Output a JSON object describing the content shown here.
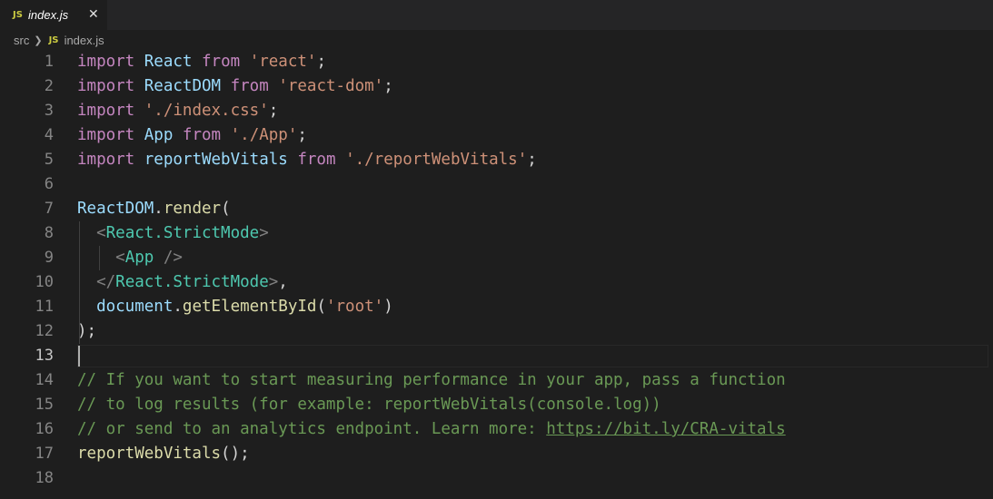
{
  "tab": {
    "icon": "JS",
    "title": "index.js",
    "close": "✕"
  },
  "breadcrumb": {
    "folder": "src",
    "sep": "❯",
    "file_icon": "JS",
    "file": "index.js"
  },
  "editor": {
    "active_line": 13,
    "lines": [
      {
        "n": "1",
        "tokens": [
          {
            "c": "kw",
            "t": "import"
          },
          {
            "t": " "
          },
          {
            "c": "var",
            "t": "React"
          },
          {
            "t": " "
          },
          {
            "c": "kw",
            "t": "from"
          },
          {
            "t": " "
          },
          {
            "c": "str",
            "t": "'react'"
          },
          {
            "t": ";"
          }
        ]
      },
      {
        "n": "2",
        "tokens": [
          {
            "c": "kw",
            "t": "import"
          },
          {
            "t": " "
          },
          {
            "c": "var",
            "t": "ReactDOM"
          },
          {
            "t": " "
          },
          {
            "c": "kw",
            "t": "from"
          },
          {
            "t": " "
          },
          {
            "c": "str",
            "t": "'react-dom'"
          },
          {
            "t": ";"
          }
        ]
      },
      {
        "n": "3",
        "tokens": [
          {
            "c": "kw",
            "t": "import"
          },
          {
            "t": " "
          },
          {
            "c": "str",
            "t": "'./index.css'"
          },
          {
            "t": ";"
          }
        ]
      },
      {
        "n": "4",
        "tokens": [
          {
            "c": "kw",
            "t": "import"
          },
          {
            "t": " "
          },
          {
            "c": "var",
            "t": "App"
          },
          {
            "t": " "
          },
          {
            "c": "kw",
            "t": "from"
          },
          {
            "t": " "
          },
          {
            "c": "str",
            "t": "'./App'"
          },
          {
            "t": ";"
          }
        ]
      },
      {
        "n": "5",
        "tokens": [
          {
            "c": "kw",
            "t": "import"
          },
          {
            "t": " "
          },
          {
            "c": "var",
            "t": "reportWebVitals"
          },
          {
            "t": " "
          },
          {
            "c": "kw",
            "t": "from"
          },
          {
            "t": " "
          },
          {
            "c": "str",
            "t": "'./reportWebVitals'"
          },
          {
            "t": ";"
          }
        ]
      },
      {
        "n": "6",
        "tokens": []
      },
      {
        "n": "7",
        "tokens": [
          {
            "c": "var",
            "t": "ReactDOM"
          },
          {
            "t": "."
          },
          {
            "c": "fn",
            "t": "render"
          },
          {
            "t": "("
          }
        ]
      },
      {
        "n": "8",
        "tokens": [
          {
            "t": "  "
          },
          {
            "c": "punc",
            "t": "<"
          },
          {
            "c": "tag",
            "t": "React.StrictMode"
          },
          {
            "c": "punc",
            "t": ">"
          }
        ]
      },
      {
        "n": "9",
        "tokens": [
          {
            "t": "    "
          },
          {
            "c": "punc",
            "t": "<"
          },
          {
            "c": "tag",
            "t": "App"
          },
          {
            "t": " "
          },
          {
            "c": "punc",
            "t": "/>"
          }
        ]
      },
      {
        "n": "10",
        "tokens": [
          {
            "t": "  "
          },
          {
            "c": "punc",
            "t": "</"
          },
          {
            "c": "tag",
            "t": "React.StrictMode"
          },
          {
            "c": "punc",
            "t": ">"
          },
          {
            "t": ","
          }
        ]
      },
      {
        "n": "11",
        "tokens": [
          {
            "t": "  "
          },
          {
            "c": "var",
            "t": "document"
          },
          {
            "t": "."
          },
          {
            "c": "fn",
            "t": "getElementById"
          },
          {
            "t": "("
          },
          {
            "c": "str",
            "t": "'root'"
          },
          {
            "t": ")"
          }
        ]
      },
      {
        "n": "12",
        "tokens": [
          {
            "t": ");"
          }
        ]
      },
      {
        "n": "13",
        "tokens": []
      },
      {
        "n": "14",
        "tokens": [
          {
            "c": "cmt",
            "t": "// If you want to start measuring performance in your app, pass a function"
          }
        ]
      },
      {
        "n": "15",
        "tokens": [
          {
            "c": "cmt",
            "t": "// to log results (for example: reportWebVitals(console.log))"
          }
        ]
      },
      {
        "n": "16",
        "tokens": [
          {
            "c": "cmt",
            "t": "// or send to an analytics endpoint. Learn more: "
          },
          {
            "c": "url",
            "t": "https://bit.ly/CRA-vitals"
          }
        ]
      },
      {
        "n": "17",
        "tokens": [
          {
            "c": "fn",
            "t": "reportWebVitals"
          },
          {
            "t": "();"
          }
        ]
      },
      {
        "n": "18",
        "tokens": []
      }
    ]
  }
}
